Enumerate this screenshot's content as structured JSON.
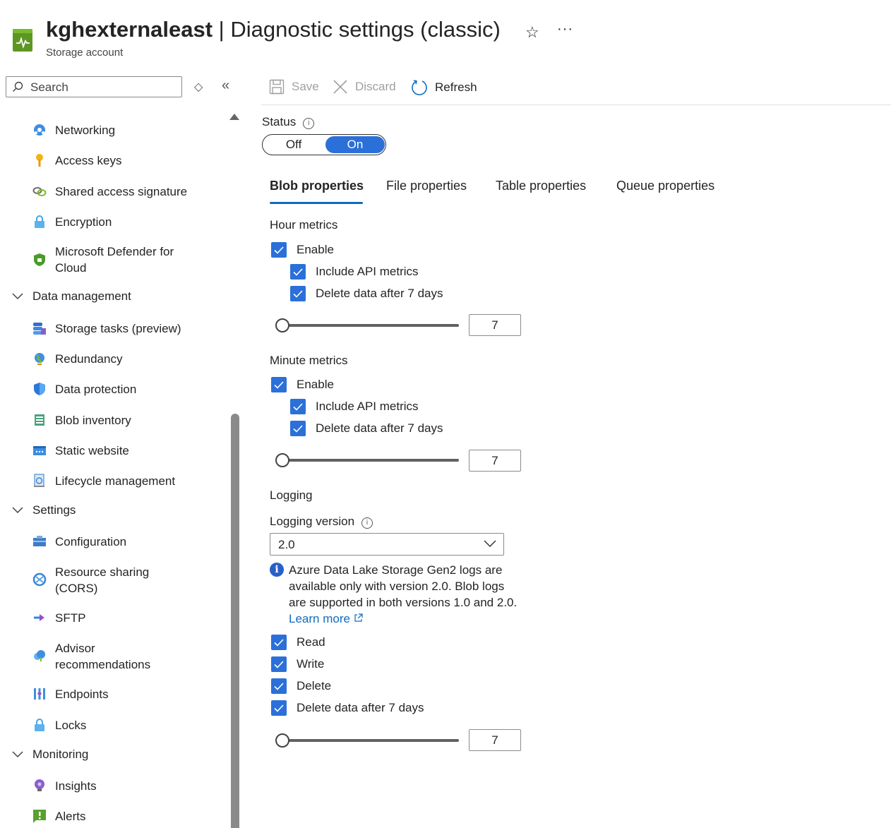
{
  "header": {
    "resource_name": "kghexternaleast",
    "separator": " | ",
    "page_name": "Diagnostic settings (classic)",
    "subtitle": "Storage account",
    "star_icon": "☆",
    "more_icon": "···"
  },
  "search": {
    "placeholder": "Search"
  },
  "nav": {
    "items": [
      {
        "label": "Networking",
        "icon": "networking-icon"
      },
      {
        "label": "Access keys",
        "icon": "key-icon"
      },
      {
        "label": "Shared access signature",
        "icon": "link-icon"
      },
      {
        "label": "Encryption",
        "icon": "lock-icon"
      },
      {
        "label": "Microsoft Defender for Cloud",
        "icon": "shield-icon"
      },
      {
        "label": "Data management",
        "group": true
      },
      {
        "label": "Storage tasks (preview)",
        "icon": "storage-tasks-icon"
      },
      {
        "label": "Redundancy",
        "icon": "globe-icon"
      },
      {
        "label": "Data protection",
        "icon": "data-protection-icon"
      },
      {
        "label": "Blob inventory",
        "icon": "inventory-icon"
      },
      {
        "label": "Static website",
        "icon": "website-icon"
      },
      {
        "label": "Lifecycle management",
        "icon": "lifecycle-icon"
      },
      {
        "label": "Settings",
        "group": true
      },
      {
        "label": "Configuration",
        "icon": "configuration-icon"
      },
      {
        "label": "Resource sharing (CORS)",
        "icon": "cors-icon"
      },
      {
        "label": "SFTP",
        "icon": "sftp-icon"
      },
      {
        "label": "Advisor recommendations",
        "icon": "advisor-icon"
      },
      {
        "label": "Endpoints",
        "icon": "endpoints-icon"
      },
      {
        "label": "Locks",
        "icon": "lock-icon"
      },
      {
        "label": "Monitoring",
        "group": true
      },
      {
        "label": "Insights",
        "icon": "insights-icon"
      },
      {
        "label": "Alerts",
        "icon": "alerts-icon"
      }
    ]
  },
  "toolbar": {
    "save": "Save",
    "discard": "Discard",
    "refresh": "Refresh"
  },
  "status": {
    "label": "Status",
    "off": "Off",
    "on": "On",
    "value": "On"
  },
  "tabs": [
    "Blob properties",
    "File properties",
    "Table properties",
    "Queue properties"
  ],
  "hour_metrics": {
    "title": "Hour metrics",
    "enable": "Enable",
    "include_api": "Include API metrics",
    "delete_after": "Delete data after 7 days",
    "days": "7"
  },
  "minute_metrics": {
    "title": "Minute metrics",
    "enable": "Enable",
    "include_api": "Include API metrics",
    "delete_after": "Delete data after 7 days",
    "days": "7"
  },
  "logging": {
    "title": "Logging",
    "version_label": "Logging version",
    "version_value": "2.0",
    "info_text": "Azure Data Lake Storage Gen2 logs are available only with version 2.0. Blob logs are supported in both versions 1.0 and 2.0.",
    "learn_more": "Learn more",
    "read": "Read",
    "write": "Write",
    "delete": "Delete",
    "delete_after": "Delete data after 7 days",
    "days": "7"
  }
}
